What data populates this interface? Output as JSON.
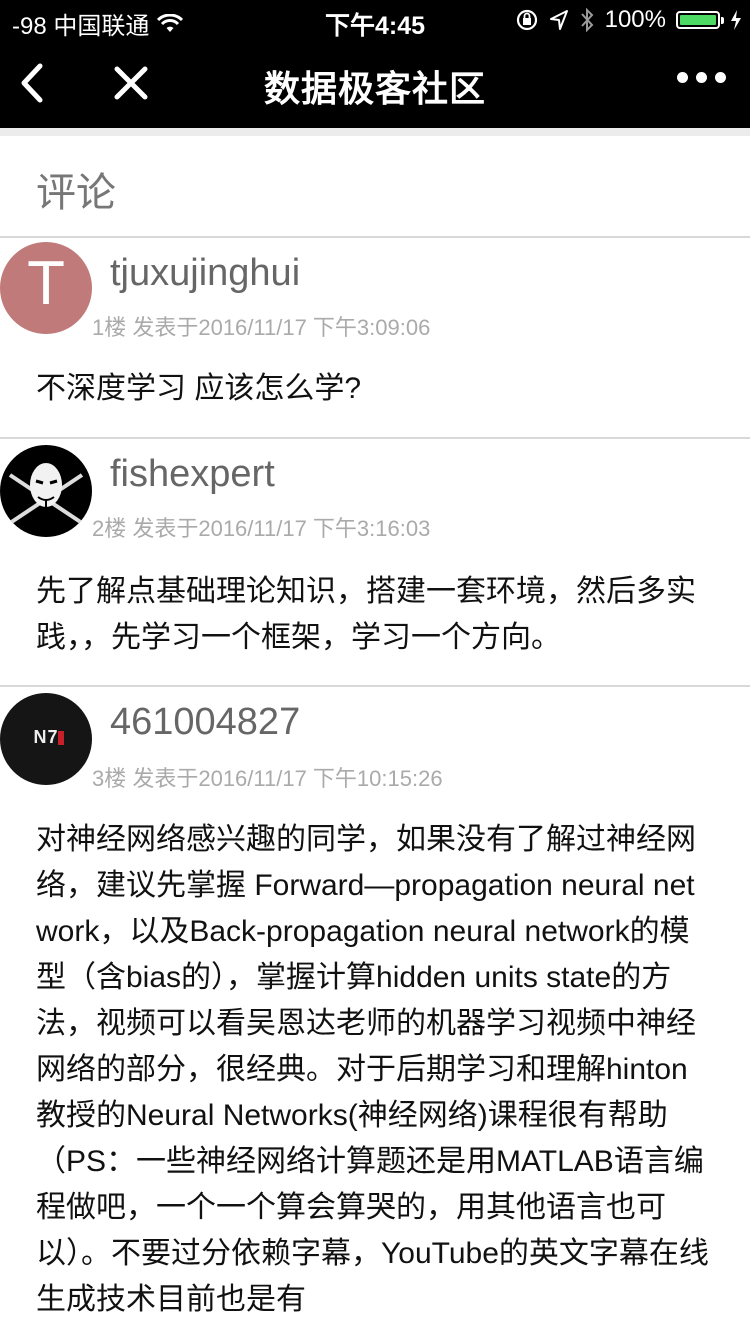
{
  "status_bar": {
    "carrier": "-98 中国联通",
    "time": "下午4:45",
    "battery": "100%"
  },
  "nav": {
    "title": "数据极客社区"
  },
  "section": {
    "title": "评论"
  },
  "comments": [
    {
      "avatar_letter": "T",
      "username": "tjuxujinghui",
      "meta": "1楼  发表于2016/11/17 下午3:09:06",
      "text": "不深度学习 应该怎么学?"
    },
    {
      "username": "fishexpert",
      "meta": "2楼  发表于2016/11/17 下午3:16:03",
      "text": "先了解点基础理论知识，搭建一套环境，然后多实践，，先学习一个框架，学习一个方向。"
    },
    {
      "avatar_text": "N7",
      "username": "461004827",
      "meta": "3楼  发表于2016/11/17 下午10:15:26",
      "text": "对神经网络感兴趣的同学，如果没有了解过神经网络，建议先掌握 Forward—propagation neural network，以及Back-propagation neural network的模型（含bias的），掌握计算hidden units state的方法，视频可以看吴恩达老师的机器学习视频中神经网络的部分，很经典。对于后期学习和理解hinton教授的Neural Networks(神经网络)课程很有帮助（PS：一些神经网络计算题还是用MATLAB语言编程做吧，一个一个算会算哭的，用其他语言也可以）。不要过分依赖字幕，YouTube的英文字幕在线生成技术目前也是有"
    }
  ]
}
